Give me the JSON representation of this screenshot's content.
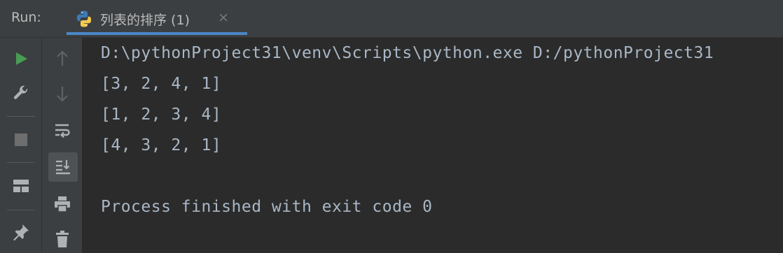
{
  "header": {
    "run_label": "Run:",
    "tab": {
      "icon": "python-icon",
      "title": "列表的排序 (1)",
      "close": "×"
    }
  },
  "left_toolbar": [
    {
      "name": "rerun-button",
      "icon": "play-icon"
    },
    {
      "name": "modify-run-config-button",
      "icon": "wrench-icon"
    },
    {
      "name": "stop-button",
      "icon": "stop-icon"
    },
    {
      "name": "restore-layout-button",
      "icon": "layout-icon"
    },
    {
      "name": "pin-tab-button",
      "icon": "pin-icon"
    }
  ],
  "right_toolbar": [
    {
      "name": "up-stack-button",
      "icon": "arrow-up-icon"
    },
    {
      "name": "down-stack-button",
      "icon": "arrow-down-icon"
    },
    {
      "name": "soft-wrap-button",
      "icon": "soft-wrap-icon"
    },
    {
      "name": "scroll-to-end-button",
      "icon": "scroll-to-end-icon"
    },
    {
      "name": "print-button",
      "icon": "print-icon"
    },
    {
      "name": "clear-all-button",
      "icon": "trash-icon"
    }
  ],
  "console": {
    "lines": [
      "D:\\pythonProject31\\venv\\Scripts\\python.exe D:/pythonProject31",
      "[3, 2, 4, 1]",
      "[1, 2, 3, 4]",
      "[4, 3, 2, 1]",
      "",
      "Process finished with exit code 0"
    ]
  },
  "colors": {
    "background": "#2b2b2b",
    "panel": "#3c3f41",
    "text": "#a9b7c6",
    "run_green": "#499c54",
    "tab_underline": "#4a88c7"
  }
}
